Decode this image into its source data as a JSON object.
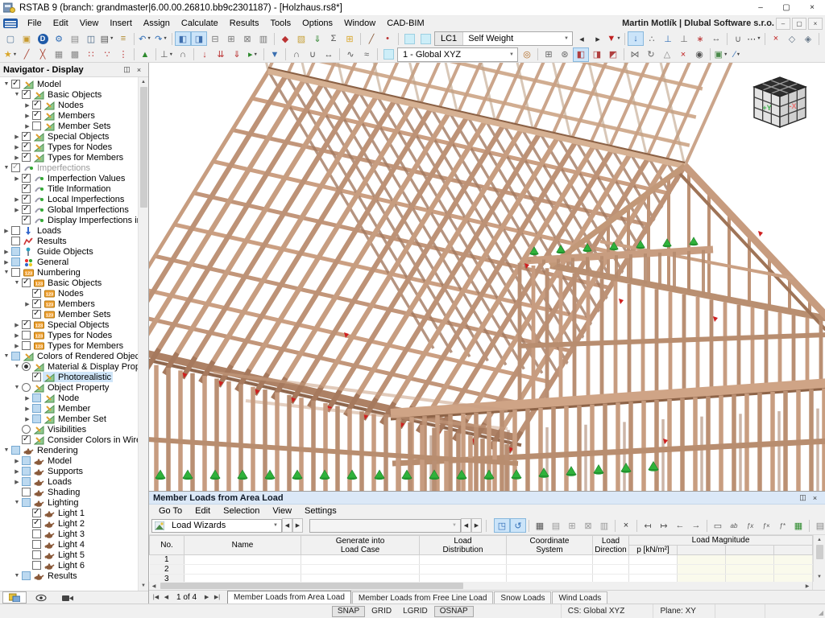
{
  "window": {
    "title": "RSTAB 9 (branch: grandmaster|6.00.00.26810.bb9c2301187) - [Holzhaus.rs8*]",
    "user": "Martin Motlík | Dlubal Software s.r.o.",
    "buttons": {
      "minimize": "–",
      "maximize": "▢",
      "close": "×"
    }
  },
  "menus": [
    "File",
    "Edit",
    "View",
    "Insert",
    "Assign",
    "Calculate",
    "Results",
    "Tools",
    "Options",
    "Window",
    "CAD-BIM"
  ],
  "toolbar1": {
    "lc_prefix": "LC1",
    "lc_value": "Self Weight",
    "icons_a": [
      {
        "n": "new-model",
        "g": "▢",
        "c": "#56789a"
      },
      {
        "n": "open-model",
        "g": "▣",
        "c": "#c79a2e"
      },
      {
        "n": "dlubal-center",
        "g": "D",
        "cls": "ic-round"
      },
      {
        "n": "program-settings",
        "g": "⚙",
        "c": "#2f6db6"
      },
      {
        "n": "printout-header",
        "g": "▤",
        "c": "#8a8a8a"
      },
      {
        "n": "save-model",
        "g": "◫",
        "c": "#3f5f7f"
      },
      {
        "n": "print-graphic",
        "g": "▤",
        "c": "#555555",
        "caret": true
      },
      {
        "n": "printout-report",
        "g": "≡",
        "c": "#b08a30"
      },
      {
        "sep": true
      },
      {
        "n": "undo",
        "g": "↶",
        "c": "#2f6db6",
        "caret": true
      },
      {
        "n": "redo",
        "g": "↷",
        "c": "#2f6db6",
        "caret": true
      },
      {
        "sep": true
      },
      {
        "n": "toggle-navigator",
        "g": "◧",
        "c": "#3f6fae",
        "on": true
      },
      {
        "n": "toggle-tables",
        "g": "◨",
        "c": "#3f6fae",
        "on": true
      },
      {
        "n": "toggle-panels",
        "g": "⊟",
        "c": "#777777"
      },
      {
        "n": "toggle-command-line",
        "g": "⊞",
        "c": "#777777"
      },
      {
        "n": "toggle-scripting",
        "g": "⊠",
        "c": "#777777"
      },
      {
        "n": "toggle-table-view",
        "g": "▥",
        "c": "#777777"
      },
      {
        "sep": true
      },
      {
        "n": "edit-sections",
        "g": "◆",
        "c": "#bb3333"
      },
      {
        "n": "edit-materials",
        "g": "▧",
        "c": "#c7a23c"
      },
      {
        "n": "edit-load-cases",
        "g": "⇓",
        "c": "#3a8a3a"
      },
      {
        "n": "edit-combinations",
        "g": "Σ",
        "c": "#555555"
      },
      {
        "n": "edit-grid",
        "g": "⊞",
        "c": "#d9a62a"
      },
      {
        "sep": true
      },
      {
        "n": "new-member",
        "g": "╱",
        "c": "#8a5a3a"
      },
      {
        "n": "new-node",
        "g": "•",
        "c": "#bb3333"
      },
      {
        "sep": true
      },
      {
        "n": "loads-display-toggle",
        "g": "",
        "cls": "ic-cyan"
      },
      {
        "n": "results-display-toggle",
        "g": "",
        "cls": "ic-cyan"
      }
    ],
    "icons_b": [
      {
        "n": "previous-load-case",
        "g": "◂",
        "c": "#333333"
      },
      {
        "n": "next-load-case",
        "g": "▸",
        "c": "#333333"
      },
      {
        "n": "filter-loads",
        "g": "▼",
        "c": "#c02020",
        "caret": true
      },
      {
        "sep": true
      },
      {
        "n": "show-loads",
        "g": "↓",
        "c": "#2f6db6",
        "on": true
      },
      {
        "n": "show-load-values",
        "g": "∴",
        "c": "#666666"
      },
      {
        "n": "show-supports",
        "g": "⊥",
        "c": "#2f6db6"
      },
      {
        "n": "show-support-values",
        "g": "⊥",
        "c": "#666666"
      },
      {
        "n": "show-nodes",
        "g": "∗",
        "c": "#bb3333"
      },
      {
        "n": "show-dimensions",
        "g": "↔",
        "c": "#666666"
      },
      {
        "sep": true
      },
      {
        "n": "member-releases",
        "g": "∪",
        "c": "#666666"
      },
      {
        "n": "numbering-display",
        "g": "⋯",
        "c": "#333333",
        "caret": true
      },
      {
        "sep": true
      },
      {
        "n": "zoom-off",
        "g": "×",
        "c": "#c02020"
      },
      {
        "n": "render-solid",
        "g": "◇",
        "c": "#667788"
      },
      {
        "n": "render-transparent",
        "g": "◈",
        "c": "#667788"
      },
      {
        "sep": true
      },
      {
        "n": "axis-indicator",
        "g": "+",
        "c": "#2f6db6"
      },
      {
        "n": "toolbar-overflow",
        "g": "»",
        "c": "#555555"
      }
    ]
  },
  "toolbar2": {
    "cs_value": "1 - Global XYZ",
    "icons_a": [
      {
        "n": "select-special",
        "g": "★",
        "c": "#d9a62a",
        "caret": true
      },
      {
        "n": "divide-member",
        "g": "╱",
        "c": "#aa4433"
      },
      {
        "n": "connect-members",
        "g": "╳",
        "c": "#aa4433"
      },
      {
        "n": "refine-mesh",
        "g": "▦",
        "c": "#888888"
      },
      {
        "n": "coarsen-mesh",
        "g": "▩",
        "c": "#888888"
      },
      {
        "n": "move-nodes",
        "g": "∷",
        "c": "#bb3333"
      },
      {
        "n": "copy-nodes",
        "g": "∵",
        "c": "#bb3333"
      },
      {
        "n": "delete-nodes",
        "g": "⋮",
        "c": "#bb3333"
      },
      {
        "sep": true
      },
      {
        "n": "select-objects",
        "g": "▲",
        "c": "#2d8a2d"
      },
      {
        "sep": true
      },
      {
        "n": "supports-tool",
        "g": "⊥",
        "c": "#555555",
        "caret": true
      },
      {
        "n": "hinges-tool",
        "g": "∩",
        "c": "#555555"
      },
      {
        "sep": true
      },
      {
        "n": "nodal-load",
        "g": "↓",
        "c": "#bb3333"
      },
      {
        "n": "member-load",
        "g": "⇊",
        "c": "#bb3333"
      },
      {
        "n": "area-load",
        "g": "⇓",
        "c": "#bb3333"
      },
      {
        "n": "generate-loads",
        "g": "▸",
        "c": "#2d8a2d",
        "caret": true
      },
      {
        "sep": true
      },
      {
        "n": "filter-view",
        "g": "▼",
        "c": "#3a6fb0"
      },
      {
        "sep": true
      },
      {
        "n": "clip-top",
        "g": "∩",
        "c": "#555555"
      },
      {
        "n": "clip-bottom",
        "g": "∪",
        "c": "#555555"
      },
      {
        "n": "measure",
        "g": "↔",
        "c": "#555555"
      },
      {
        "sep": true
      },
      {
        "n": "line-smooth",
        "g": "∿",
        "c": "#555555"
      },
      {
        "n": "line-rough",
        "g": "≈",
        "c": "#555555"
      },
      {
        "sep": true
      },
      {
        "n": "workplane-display-toggle",
        "g": "",
        "cls": "ic-cyan"
      }
    ],
    "icons_b": [
      {
        "n": "zoom-window",
        "g": "◎",
        "c": "#b06820"
      },
      {
        "sep": true
      },
      {
        "n": "show-grid",
        "g": "⊞",
        "c": "#666666"
      },
      {
        "n": "show-snap",
        "g": "⊛",
        "c": "#666666"
      },
      {
        "n": "workplane-xy",
        "g": "◧",
        "c": "#b04040",
        "on": true
      },
      {
        "n": "workplane-yz",
        "g": "◨",
        "c": "#b04040"
      },
      {
        "n": "workplane-xz",
        "g": "◩",
        "c": "#b04040"
      },
      {
        "sep": true
      },
      {
        "n": "connect-chain",
        "g": "⋈",
        "c": "#666666"
      },
      {
        "n": "rotate-view",
        "g": "↻",
        "c": "#666666"
      },
      {
        "n": "perspective-view",
        "g": "△",
        "c": "#888888"
      },
      {
        "n": "delete-objects",
        "g": "×",
        "c": "#c02020"
      },
      {
        "n": "screenshot",
        "g": "◉",
        "c": "#555555"
      },
      {
        "sep": true
      },
      {
        "n": "background-image",
        "g": "▣",
        "c": "#4a8a4a",
        "caret": true
      },
      {
        "n": "drawing-tools",
        "g": "∕",
        "c": "#2f6db6",
        "caret": true
      }
    ]
  },
  "navigator": {
    "title": "Navigator - Display",
    "items": [
      {
        "l": 0,
        "e": "v",
        "c": "c",
        "i": "d",
        "t": "Model"
      },
      {
        "l": 1,
        "e": "v",
        "c": "c",
        "i": "d",
        "t": "Basic Objects"
      },
      {
        "l": 2,
        "e": ">",
        "c": "c",
        "i": "d",
        "t": "Nodes"
      },
      {
        "l": 2,
        "e": ">",
        "c": "c",
        "i": "d",
        "t": "Members"
      },
      {
        "l": 2,
        "e": ">",
        "c": "u",
        "i": "d",
        "t": "Member Sets"
      },
      {
        "l": 1,
        "e": ">",
        "c": "c",
        "i": "d",
        "t": "Special Objects"
      },
      {
        "l": 1,
        "e": ">",
        "c": "c",
        "i": "d",
        "t": "Types for Nodes"
      },
      {
        "l": 1,
        "e": ">",
        "c": "c",
        "i": "d",
        "t": "Types for Members"
      },
      {
        "l": 0,
        "e": "v",
        "c": "g",
        "i": "i",
        "t": "Imperfections",
        "gy": 1
      },
      {
        "l": 1,
        "e": ">",
        "c": "c",
        "i": "i",
        "t": "Imperfection Values"
      },
      {
        "l": 1,
        "e": "",
        "c": "c",
        "i": "i",
        "t": "Title Information"
      },
      {
        "l": 1,
        "e": ">",
        "c": "c",
        "i": "i",
        "t": "Local Imperfections"
      },
      {
        "l": 1,
        "e": ">",
        "c": "c",
        "i": "i",
        "t": "Global Imperfections"
      },
      {
        "l": 1,
        "e": "",
        "c": "c",
        "i": "i",
        "t": "Display Imperfections in L..."
      },
      {
        "l": 0,
        "e": ">",
        "c": "u",
        "i": "L",
        "t": "Loads"
      },
      {
        "l": 0,
        "e": "",
        "c": "u",
        "i": "R",
        "t": "Results"
      },
      {
        "l": 0,
        "e": ">",
        "c": "p",
        "i": "G",
        "t": "Guide Objects"
      },
      {
        "l": 0,
        "e": ">",
        "c": "p",
        "i": "N",
        "t": "General"
      },
      {
        "l": 0,
        "e": "v",
        "c": "u",
        "i": "n",
        "t": "Numbering"
      },
      {
        "l": 1,
        "e": "v",
        "c": "c",
        "i": "n",
        "t": "Basic Objects"
      },
      {
        "l": 2,
        "e": "",
        "c": "c",
        "i": "n",
        "t": "Nodes"
      },
      {
        "l": 2,
        "e": ">",
        "c": "c",
        "i": "n",
        "t": "Members"
      },
      {
        "l": 2,
        "e": "",
        "c": "c",
        "i": "n",
        "t": "Member Sets"
      },
      {
        "l": 1,
        "e": ">",
        "c": "c",
        "i": "n",
        "t": "Special Objects"
      },
      {
        "l": 1,
        "e": ">",
        "c": "u",
        "i": "n",
        "t": "Types for Nodes"
      },
      {
        "l": 1,
        "e": ">",
        "c": "u",
        "i": "n",
        "t": "Types for Members"
      },
      {
        "l": 0,
        "e": "v",
        "c": "p",
        "i": "d",
        "t": "Colors of Rendered Objects by"
      },
      {
        "l": 1,
        "e": "v",
        "c": "r1",
        "i": "d",
        "t": "Material & Display Proper..."
      },
      {
        "l": 2,
        "e": "",
        "c": "c",
        "i": "d",
        "t": "Photorealistic",
        "s": 1
      },
      {
        "l": 1,
        "e": "v",
        "c": "r0",
        "i": "d",
        "t": "Object Property"
      },
      {
        "l": 2,
        "e": ">",
        "c": "p",
        "i": "d",
        "t": "Node"
      },
      {
        "l": 2,
        "e": ">",
        "c": "p",
        "i": "d",
        "t": "Member"
      },
      {
        "l": 2,
        "e": ">",
        "c": "p",
        "i": "d",
        "t": "Member Set"
      },
      {
        "l": 1,
        "e": "",
        "c": "r0",
        "i": "d",
        "t": "Visibilities"
      },
      {
        "l": 1,
        "e": "",
        "c": "c",
        "i": "d",
        "t": "Consider Colors in Wirefr..."
      },
      {
        "l": 0,
        "e": "v",
        "c": "p",
        "i": "t",
        "t": "Rendering"
      },
      {
        "l": 1,
        "e": ">",
        "c": "p",
        "i": "t",
        "t": "Model"
      },
      {
        "l": 1,
        "e": ">",
        "c": "p",
        "i": "t",
        "t": "Supports"
      },
      {
        "l": 1,
        "e": ">",
        "c": "p",
        "i": "t",
        "t": "Loads"
      },
      {
        "l": 1,
        "e": "",
        "c": "u",
        "i": "t",
        "t": "Shading"
      },
      {
        "l": 1,
        "e": "v",
        "c": "p",
        "i": "t",
        "t": "Lighting"
      },
      {
        "l": 2,
        "e": "",
        "c": "c",
        "i": "t",
        "t": "Light 1"
      },
      {
        "l": 2,
        "e": "",
        "c": "c",
        "i": "t",
        "t": "Light 2"
      },
      {
        "l": 2,
        "e": "",
        "c": "u",
        "i": "t",
        "t": "Light 3"
      },
      {
        "l": 2,
        "e": "",
        "c": "u",
        "i": "t",
        "t": "Light 4"
      },
      {
        "l": 2,
        "e": "",
        "c": "u",
        "i": "t",
        "t": "Light 5"
      },
      {
        "l": 2,
        "e": "",
        "c": "u",
        "i": "t",
        "t": "Light 6"
      },
      {
        "l": 1,
        "e": "v",
        "c": "p",
        "i": "t",
        "t": "Results"
      }
    ]
  },
  "viewcube": {
    "left": "+Y",
    "right": "-X"
  },
  "panel": {
    "title": "Member Loads from Area Load",
    "menus": [
      "Go To",
      "Edit",
      "Selection",
      "View",
      "Settings"
    ],
    "wizard": "Load Wizards",
    "toolbar": [
      {
        "n": "view-in-model",
        "g": "◳",
        "c": "#2f6db6",
        "on": true
      },
      {
        "n": "sync-selection",
        "g": "↺",
        "c": "#2f6db6",
        "on": true
      },
      {
        "sep": true
      },
      {
        "n": "table-edit-mode",
        "g": "▦",
        "c": "#555555"
      },
      {
        "n": "table-view-mode",
        "g": "▤",
        "c": "#999999"
      },
      {
        "n": "insert-row",
        "g": "⊞",
        "c": "#999999"
      },
      {
        "n": "delete-row",
        "g": "⊠",
        "c": "#999999"
      },
      {
        "n": "row-settings",
        "g": "▥",
        "c": "#999999"
      },
      {
        "sep": true
      },
      {
        "n": "delete-all-rows",
        "g": "×",
        "c": "#333333"
      },
      {
        "sep": true
      },
      {
        "n": "import-clipboard",
        "g": "↤",
        "c": "#555555"
      },
      {
        "n": "export-clipboard",
        "g": "↦",
        "c": "#555555"
      },
      {
        "n": "paste-left",
        "g": "←",
        "c": "#555555"
      },
      {
        "n": "paste-right",
        "g": "→",
        "c": "#555555"
      },
      {
        "sep": true
      },
      {
        "n": "freeze-pane",
        "g": "▭",
        "c": "#555555"
      },
      {
        "n": "rename-cells",
        "g": "ab",
        "cls": "ic-txt",
        "c": "#555555"
      },
      {
        "n": "formula",
        "g": "ƒx",
        "cls": "ic-txt",
        "c": "#555555"
      },
      {
        "n": "formula-clear",
        "g": "ƒ×",
        "cls": "ic-txt",
        "c": "#555555"
      },
      {
        "n": "formula-edit",
        "g": "ƒ*",
        "cls": "ic-txt",
        "c": "#555555"
      },
      {
        "n": "calculator",
        "g": "▦",
        "c": "#2d8a2d"
      },
      {
        "sep": true
      },
      {
        "n": "table-settings",
        "g": "▤",
        "c": "#888888"
      },
      {
        "n": "decimal-places",
        "g": "0.00",
        "cls": "ic-dec"
      }
    ],
    "table": {
      "col_no": "No.",
      "col_name": "Name",
      "col_gen": [
        "Generate into",
        "Load Case"
      ],
      "col_dist": [
        "Load",
        "Distribution"
      ],
      "col_coord": [
        "Coordinate",
        "System"
      ],
      "col_dir": [
        "Load",
        "Direction"
      ],
      "col_mag": "Load Magnitude",
      "col_p": "p [kN/m²]",
      "rows": [
        "1",
        "2",
        "3"
      ]
    },
    "pager": "1 of 4",
    "pager_buttons": [
      "|◀",
      "◀",
      "▶",
      "▶|"
    ],
    "tabs": [
      {
        "label": "Member Loads from Area Load",
        "active": true
      },
      {
        "label": "Member Loads from Free Line Load",
        "active": false
      },
      {
        "label": "Snow Loads",
        "active": false
      },
      {
        "label": "Wind Loads",
        "active": false
      }
    ]
  },
  "status": {
    "toggles": [
      {
        "label": "SNAP",
        "on": true
      },
      {
        "label": "GRID",
        "on": false
      },
      {
        "label": "LGRID",
        "on": false
      },
      {
        "label": "OSNAP",
        "on": true
      }
    ],
    "cs": "CS: Global XYZ",
    "plane": "Plane: XY"
  },
  "colors": {
    "wood_mid": "#c09878",
    "wood_light": "#d2ac8e",
    "wood_dark": "#a07a5f",
    "wood_deep": "#8a6248",
    "marker_red": "#cf1f1f",
    "cone_green": "#2fb23b",
    "cone_dark": "#1d7f28",
    "select_blue": "#cde6f7"
  }
}
